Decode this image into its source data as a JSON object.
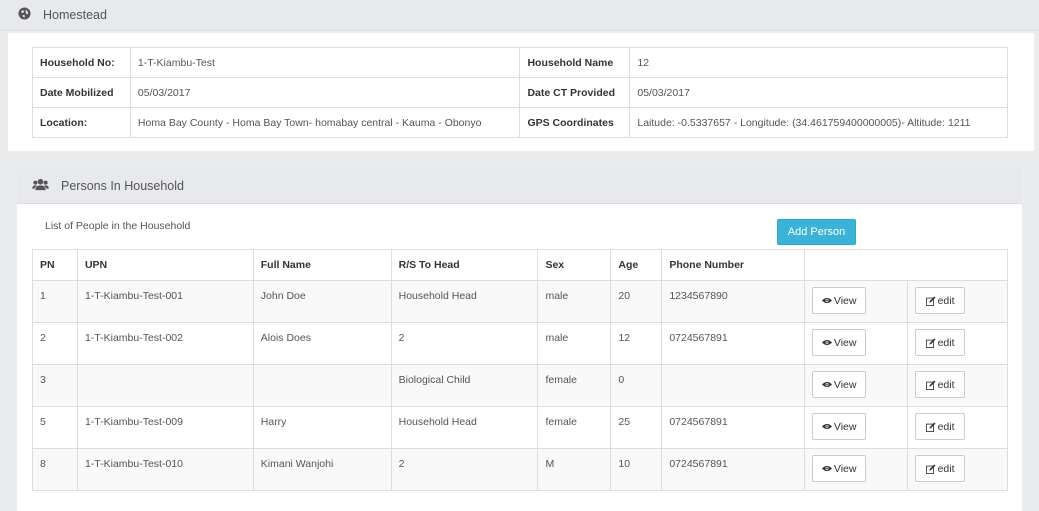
{
  "homestead": {
    "title": "Homestead",
    "icon": "globe-icon",
    "fields": [
      [
        {
          "label": "Household No:",
          "value": "1-T-Kiambu-Test"
        },
        {
          "label": "Household Name",
          "value": "12"
        }
      ],
      [
        {
          "label": "Date Mobilized",
          "value": "05/03/2017"
        },
        {
          "label": "Date CT Provided",
          "value": "05/03/2017"
        }
      ],
      [
        {
          "label": "Location:",
          "value": "Homa Bay County - Homa Bay Town- homabay central - Kauma - Obonyo"
        },
        {
          "label": "GPS Coordinates",
          "value": "Laitude: -0.5337657 - Longitude: (34.461759400000005)- Altitude: 1211"
        }
      ]
    ]
  },
  "persons": {
    "title": "Persons In Household",
    "icon": "users-icon",
    "caption": "List of People in the Household",
    "add_button": "Add Person",
    "columns": [
      "PN",
      "UPN",
      "Full Name",
      "R/S To Head",
      "Sex",
      "Age",
      "Phone Number"
    ],
    "view_label": "View",
    "edit_label": "edit",
    "rows": [
      {
        "pn": "1",
        "upn": "1-T-Kiambu-Test-001",
        "name": "John Doe",
        "rs": "Household Head",
        "sex": "male",
        "age": "20",
        "phone": "1234567890"
      },
      {
        "pn": "2",
        "upn": "1-T-Kiambu-Test-002",
        "name": "Alois Does",
        "rs": "2",
        "sex": "male",
        "age": "12",
        "phone": "0724567891"
      },
      {
        "pn": "3",
        "upn": "",
        "name": "",
        "rs": "Biological Child",
        "sex": "female",
        "age": "0",
        "phone": ""
      },
      {
        "pn": "5",
        "upn": "1-T-Kiambu-Test-009",
        "name": "Harry",
        "rs": "Household Head",
        "sex": "female",
        "age": "25",
        "phone": "0724567891"
      },
      {
        "pn": "8",
        "upn": "1-T-Kiambu-Test-010",
        "name": "Kimani Wanjohi",
        "rs": "2",
        "sex": "M",
        "age": "10",
        "phone": "0724567891"
      }
    ]
  },
  "colors": {
    "accent": "#39b3d7",
    "heading_bg": "#e8e9ec"
  }
}
